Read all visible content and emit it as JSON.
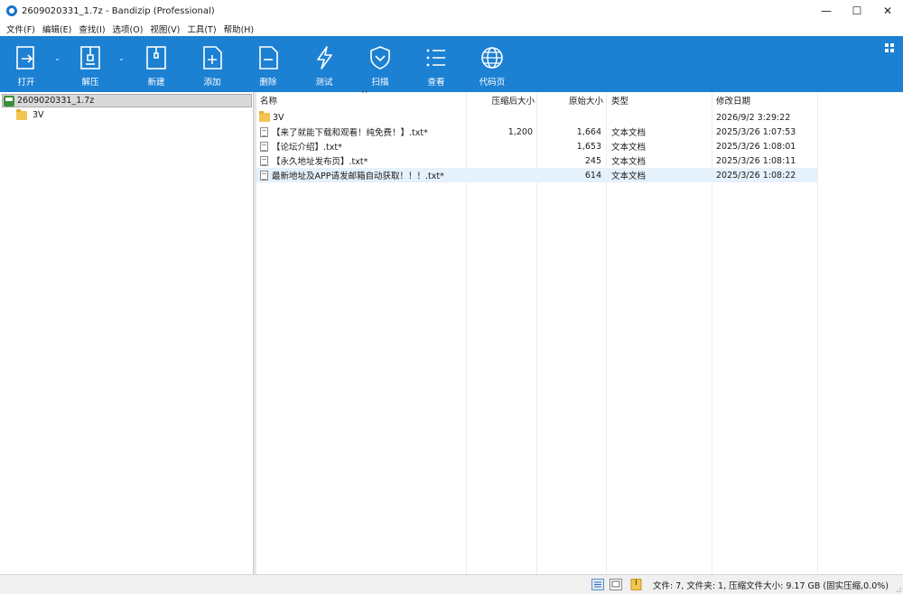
{
  "window": {
    "title": "2609020331_1.7z - Bandizip (Professional)",
    "minimize_glyph": "—",
    "maximize_glyph": "☐",
    "close_glyph": "✕"
  },
  "menu": [
    "文件(F)",
    "编辑(E)",
    "查找(I)",
    "选项(O)",
    "视图(V)",
    "工具(T)",
    "帮助(H)"
  ],
  "toolbar": {
    "open": "打开",
    "extract": "解压",
    "new": "新建",
    "add": "添加",
    "delete": "删除",
    "test": "测试",
    "scan": "扫描",
    "view": "查看",
    "codepage": "代码页",
    "dropdown_glyph": "⌄"
  },
  "tree": {
    "root": "2609020331_1.7z",
    "children": [
      "3V"
    ]
  },
  "list": {
    "columns": {
      "name": "名称",
      "packed": "压缩后大小",
      "size": "原始大小",
      "type": "类型",
      "modified": "修改日期"
    },
    "sort_glyph": "^",
    "rows": [
      {
        "name": "3V",
        "packed": "",
        "size": "",
        "type": "",
        "modified": "2026/9/2 3:29:22",
        "kind": "folder"
      },
      {
        "name": "【来了就能下载和观看！纯免费！】.txt*",
        "packed": "1,200",
        "size": "1,664",
        "type": "文本文档",
        "modified": "2025/3/26 1:07:53",
        "kind": "txt"
      },
      {
        "name": "【论坛介绍】.txt*",
        "packed": "",
        "size": "1,653",
        "type": "文本文档",
        "modified": "2025/3/26 1:08:01",
        "kind": "txt"
      },
      {
        "name": "【永久地址发布页】.txt*",
        "packed": "",
        "size": "245",
        "type": "文本文档",
        "modified": "2025/3/26 1:08:11",
        "kind": "txt"
      },
      {
        "name": "最新地址及APP请发邮箱自动获取！！！.txt*",
        "packed": "",
        "size": "614",
        "type": "文本文档",
        "modified": "2025/3/26 1:08:22",
        "kind": "txt"
      }
    ]
  },
  "status": {
    "text": "文件: 7, 文件夹: 1, 压缩文件大小: 9.17 GB (固实压缩,0.0%)"
  },
  "colors": {
    "toolbar": "#1c80d3",
    "selection": "#e5f1fb"
  }
}
